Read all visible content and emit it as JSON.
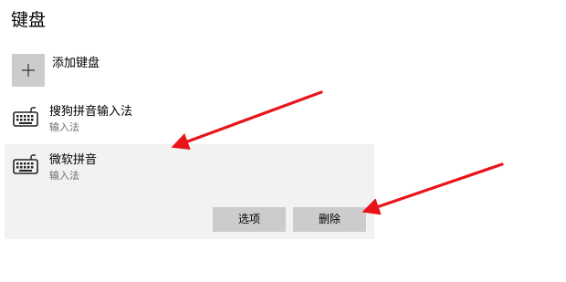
{
  "section": {
    "title": "键盘"
  },
  "add_keyboard": {
    "label": "添加键盘",
    "icon": "plus-icon"
  },
  "keyboards": [
    {
      "name": "搜狗拼音输入法",
      "subtitle": "输入法",
      "icon": "keyboard-icon"
    },
    {
      "name": "微软拼音",
      "subtitle": "输入法",
      "icon": "keyboard-icon",
      "selected": true
    }
  ],
  "actions": {
    "options_label": "选项",
    "delete_label": "删除"
  },
  "colors": {
    "arrow": "#e8141a",
    "selected_background": "#f2f2f2",
    "button_background": "#cccccc",
    "tile_background": "#cccccc",
    "secondary_text": "#6b6b6b"
  }
}
